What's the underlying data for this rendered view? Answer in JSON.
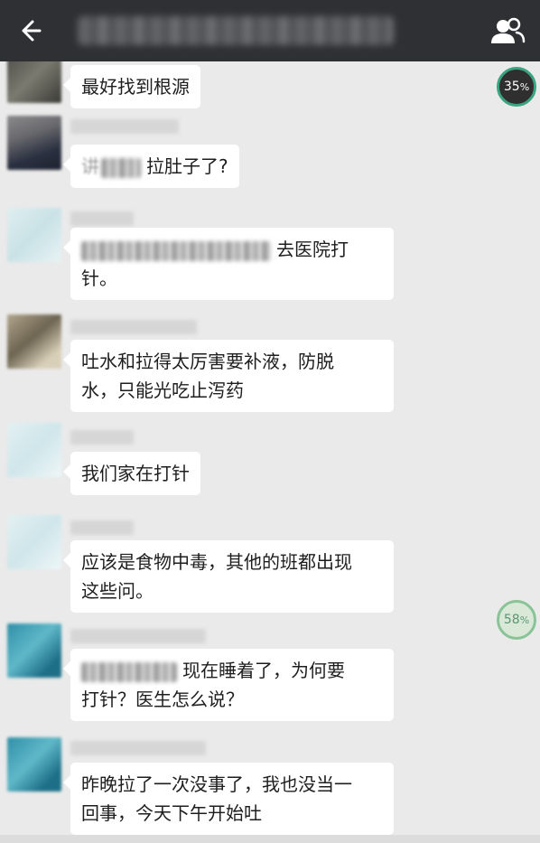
{
  "header": {
    "back_icon": "arrow-left-icon",
    "group_icon": "group-members-icon",
    "background": "#2e3033"
  },
  "progress": {
    "top_value": "35",
    "top_unit": "%",
    "bottom_value": "58",
    "bottom_unit": "%"
  },
  "messages": [
    {
      "text": "最好找到根源"
    },
    {
      "prefix_text": "讲",
      "text": "拉肚子了?"
    },
    {
      "text": "去医院打针。"
    },
    {
      "line1": "吐水和拉得太厉害要补液，防脱",
      "line2": "水，只能光吃止泻药"
    },
    {
      "text": "我们家在打针"
    },
    {
      "line1": "应该是食物中毒，其他的班都出现",
      "line2": "这些问。"
    },
    {
      "line1": "现在睡着了，为何要",
      "line2": "打针？医生怎么说？"
    },
    {
      "line1": "昨晚拉了一次没事了，我也没当一",
      "line2": "回事，今天下午开始吐"
    }
  ]
}
